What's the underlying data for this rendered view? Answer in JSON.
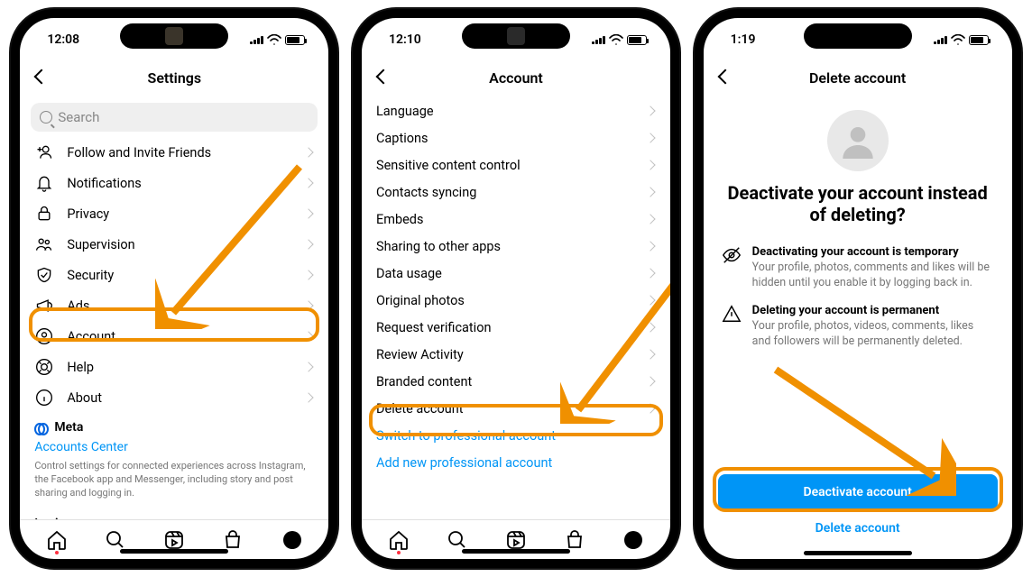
{
  "phone1": {
    "time": "12:08",
    "title": "Settings",
    "search_placeholder": "Search",
    "items": [
      {
        "key": "follow",
        "label": "Follow and Invite Friends"
      },
      {
        "key": "notifications",
        "label": "Notifications"
      },
      {
        "key": "privacy",
        "label": "Privacy"
      },
      {
        "key": "supervision",
        "label": "Supervision"
      },
      {
        "key": "security",
        "label": "Security"
      },
      {
        "key": "ads",
        "label": "Ads"
      },
      {
        "key": "account",
        "label": "Account"
      },
      {
        "key": "help",
        "label": "Help"
      },
      {
        "key": "about",
        "label": "About"
      }
    ],
    "meta_label": "Meta",
    "accounts_center": "Accounts Center",
    "meta_desc": "Control settings for connected experiences across Instagram, the Facebook app and Messenger, including story and post sharing and logging in.",
    "logins_label": "Logins"
  },
  "phone2": {
    "time": "12:10",
    "title": "Account",
    "items": [
      {
        "key": "language",
        "label": "Language"
      },
      {
        "key": "captions",
        "label": "Captions"
      },
      {
        "key": "sensitive",
        "label": "Sensitive content control"
      },
      {
        "key": "contacts",
        "label": "Contacts syncing"
      },
      {
        "key": "embeds",
        "label": "Embeds"
      },
      {
        "key": "sharing",
        "label": "Sharing to other apps"
      },
      {
        "key": "data",
        "label": "Data usage"
      },
      {
        "key": "original",
        "label": "Original photos"
      },
      {
        "key": "verify",
        "label": "Request verification"
      },
      {
        "key": "review",
        "label": "Review Activity"
      },
      {
        "key": "branded",
        "label": "Branded content"
      },
      {
        "key": "delete",
        "label": "Delete account"
      }
    ],
    "switch_pro": "Switch to professional account",
    "add_pro": "Add new professional account"
  },
  "phone3": {
    "time": "1:19",
    "title": "Delete account",
    "headline": "Deactivate your account instead of deleting?",
    "info1_title": "Deactivating your account is temporary",
    "info1_body": "Your profile, photos, comments and likes will be hidden until you enable it by logging back in.",
    "info2_title": "Deleting your account is permanent",
    "info2_body": "Your profile, photos, videos, comments, likes and followers will be permanently deleted.",
    "deactivate_btn": "Deactivate account",
    "delete_link": "Delete account"
  }
}
